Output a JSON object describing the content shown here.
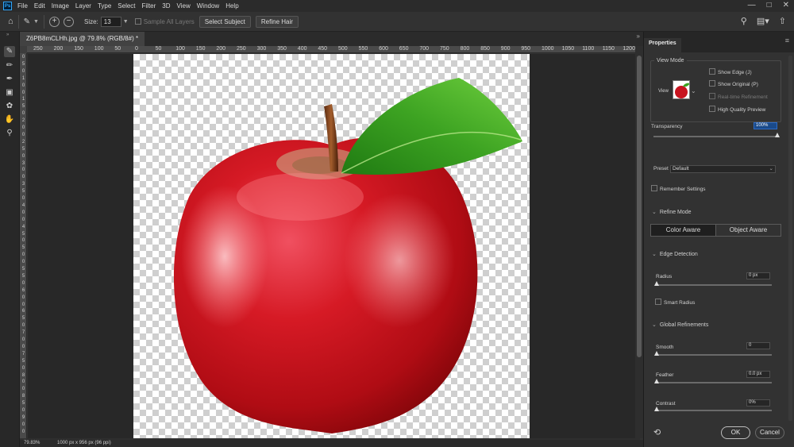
{
  "menu": {
    "logo": "Ps",
    "items": [
      "File",
      "Edit",
      "Image",
      "Layer",
      "Type",
      "Select",
      "Filter",
      "3D",
      "View",
      "Window",
      "Help"
    ]
  },
  "options_bar": {
    "size_label": "Size:",
    "size_value": "13",
    "sample_all_layers": "Sample All Layers",
    "select_subject": "Select Subject",
    "refine_hair": "Refine Hair"
  },
  "document": {
    "tab_title": "Z6PB8mCLHh.jpg @ 79.8% (RGB/8#) *",
    "status_zoom": "79.83%",
    "status_info": "1000 px x 956 px (96 ppi)"
  },
  "ruler_top": [
    "250",
    "200",
    "150",
    "100",
    "50",
    "0",
    "50",
    "100",
    "150",
    "200",
    "250",
    "300",
    "350",
    "400",
    "450",
    "500",
    "550",
    "600",
    "650",
    "700",
    "750",
    "800",
    "850",
    "900",
    "950",
    "1000",
    "1050",
    "1100",
    "1150",
    "1200"
  ],
  "ruler_left": [
    "0",
    "5",
    "0",
    "1",
    "0",
    "0",
    "1",
    "5",
    "0",
    "2",
    "0",
    "0",
    "2",
    "5",
    "0",
    "3",
    "0",
    "0",
    "3",
    "5",
    "0",
    "4",
    "0",
    "0",
    "4",
    "5",
    "0",
    "5",
    "0",
    "0",
    "5",
    "5",
    "0",
    "6",
    "0",
    "0",
    "6",
    "5",
    "0",
    "7",
    "0",
    "0",
    "7",
    "5",
    "0",
    "8",
    "0",
    "0",
    "8",
    "5",
    "0",
    "9",
    "0",
    "0"
  ],
  "properties": {
    "tab": "Properties",
    "view_mode_title": "View Mode",
    "view_label": "View",
    "show_edge": "Show Edge (J)",
    "show_original": "Show Original (P)",
    "realtime_refinement": "Real-time Refinement",
    "high_quality_preview": "High Quality Preview",
    "transparency_label": "Transparency",
    "transparency_value": "100%",
    "preset_label": "Preset",
    "preset_value": "Default",
    "remember_settings": "Remember Settings",
    "refine_mode_title": "Refine Mode",
    "color_aware": "Color Aware",
    "object_aware": "Object Aware",
    "edge_detection_title": "Edge Detection",
    "radius_label": "Radius",
    "radius_value": "0 px",
    "smart_radius": "Smart Radius",
    "global_refinements_title": "Global Refinements",
    "smooth_label": "Smooth",
    "smooth_value": "0",
    "feather_label": "Feather",
    "feather_value": "0.0 px",
    "contrast_label": "Contrast",
    "contrast_value": "0%",
    "ok": "OK",
    "cancel": "Cancel",
    "transparency_level": 1.0,
    "radius_level": 0,
    "smooth_level": 0,
    "feather_level": 0,
    "contrast_level": 0
  }
}
